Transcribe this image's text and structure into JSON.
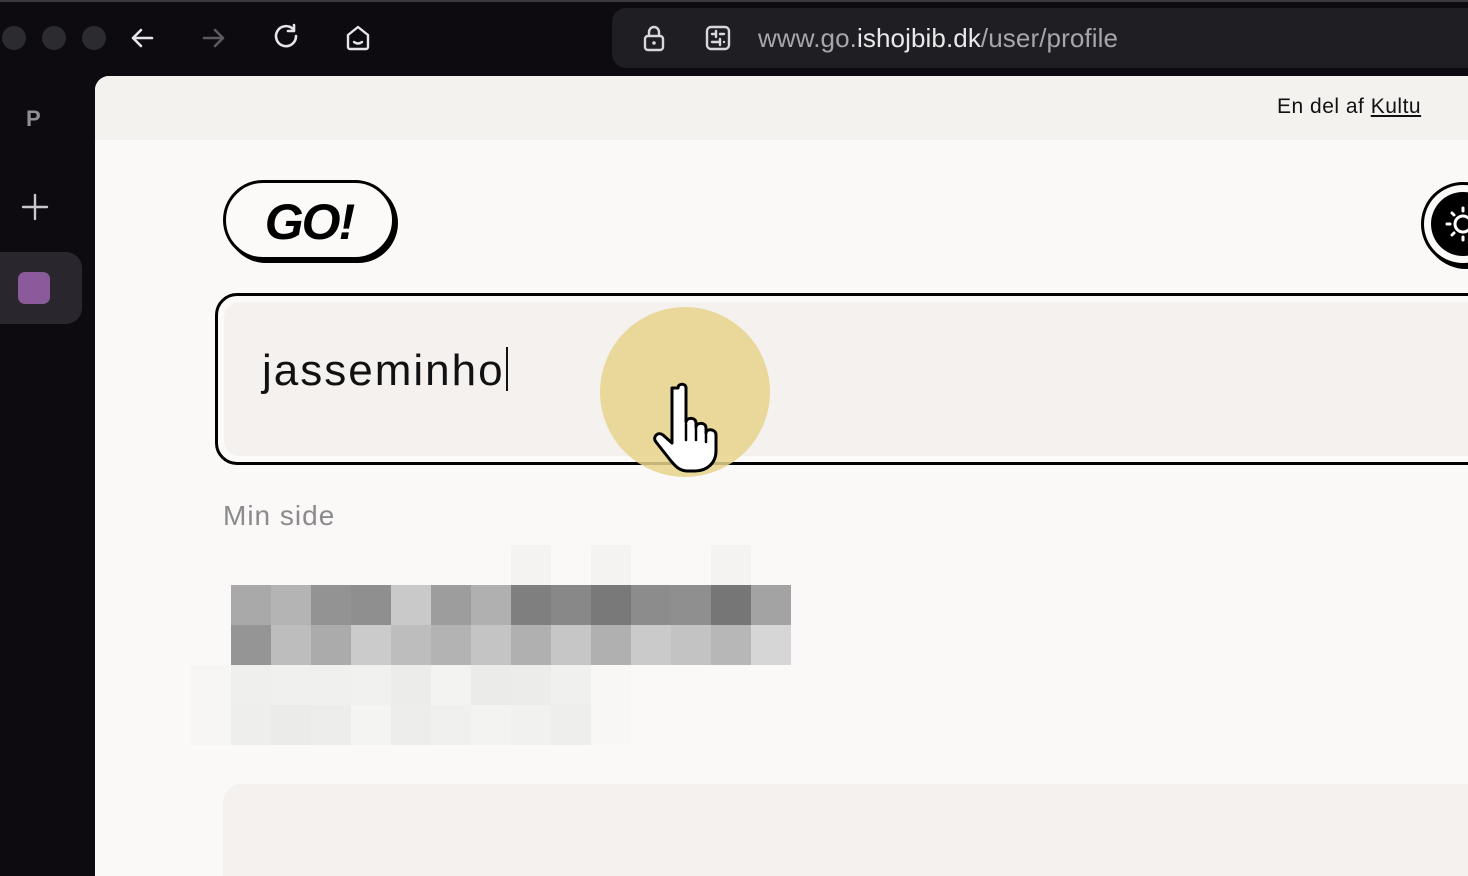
{
  "browser": {
    "url_prefix": "www.go.",
    "url_host": "ishojbib.dk",
    "url_path": "/user/profile",
    "icons": [
      "back-arrow-icon",
      "forward-arrow-icon",
      "reload-icon",
      "home-icon",
      "lock-icon",
      "site-settings-icon"
    ]
  },
  "sidebar": {
    "profile_letter": "P",
    "tab_color": "#8b5a9b"
  },
  "site": {
    "topbar_text": "En del af",
    "topbar_link": "Kultu",
    "logo_text": "GO!",
    "search_value": "jasseminho",
    "section_heading": "Min side"
  },
  "colors": {
    "page_bg": "#faf9f7",
    "cursor_highlight": "#e8d48c"
  }
}
